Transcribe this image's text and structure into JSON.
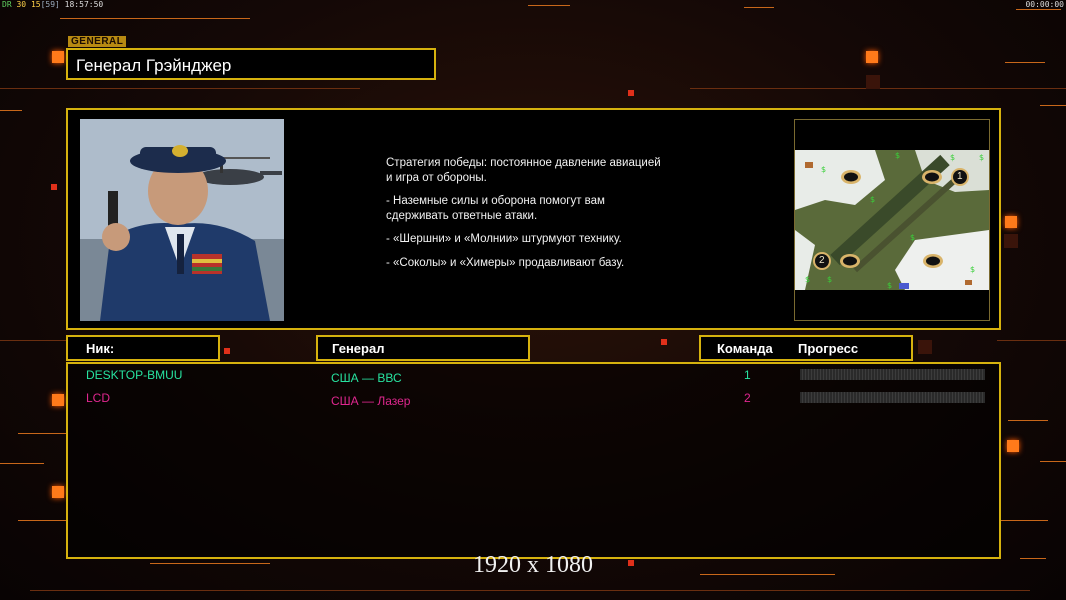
{
  "hud": {
    "fps_prefix": "DR",
    "fps_a": "30",
    "fps_b": "15",
    "fps_c": "[59]",
    "clock": "18:57:50",
    "timer": "00:00:00"
  },
  "general": {
    "tag": "GENERAL",
    "name": "Генерал Грэйнджер"
  },
  "strategy": {
    "lines": [
      "Стратегия победы: постоянное давление авиацией\n и игра от обороны.",
      "- Наземные силы и оборона помогут вам\n сдерживать ответные атаки.",
      "- «Шершни» и «Молнии» штурмуют технику.",
      "- «Соколы» и «Химеры» продавливают базу."
    ]
  },
  "minimap": {
    "start_labels": [
      "1",
      "2"
    ]
  },
  "headers": {
    "nick": "Ник:",
    "general": "Генерал",
    "team": "Команда",
    "progress": "Прогресс"
  },
  "players": [
    {
      "nick": "DESKTOP-BMUU",
      "general": "США — ВВС",
      "team": "1",
      "color": "#27e3a0",
      "progress": 0
    },
    {
      "nick": "LCD",
      "general": "США — Лазер",
      "team": "2",
      "color": "#e0278f",
      "progress": 0
    }
  ],
  "resolution": "1920 x 1080",
  "colors": {
    "accent": "#d6b20e",
    "orange": "#ff7a1a"
  }
}
